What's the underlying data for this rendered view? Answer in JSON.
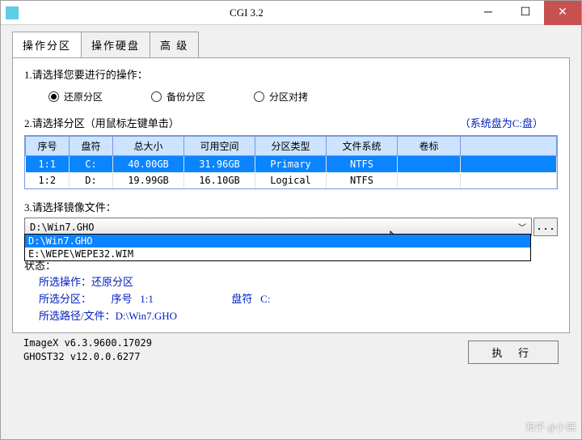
{
  "titlebar": {
    "title": "CGI 3.2"
  },
  "tabs": {
    "t1": "操作分区",
    "t2": "操作硬盘",
    "t3": "高 级"
  },
  "section1": {
    "label": "1.请选择您要进行的操作：",
    "opt_restore": "还原分区",
    "opt_backup": "备份分区",
    "opt_copy": "分区对拷"
  },
  "section2": {
    "label": "2.请选择分区（用鼠标左键单击）",
    "hint": "（系统盘为C:盘）",
    "headers": {
      "seq": "序号",
      "drive": "盘符",
      "total": "总大小",
      "free": "可用空间",
      "ptype": "分区类型",
      "fs": "文件系统",
      "label": "卷标",
      "blank": ""
    },
    "rows": [
      {
        "seq": "1:1",
        "drive": "C:",
        "total": "40.00GB",
        "free": "31.96GB",
        "ptype": "Primary",
        "fs": "NTFS",
        "label": "",
        "selected": true
      },
      {
        "seq": "1:2",
        "drive": "D:",
        "total": "19.99GB",
        "free": "16.10GB",
        "ptype": "Logical",
        "fs": "NTFS",
        "label": "",
        "selected": false
      }
    ]
  },
  "section3": {
    "label": "3.请选择镜像文件：",
    "combo_value": "D:\\Win7.GHO",
    "browse": "...",
    "options": [
      {
        "text": "D:\\Win7.GHO",
        "hl": true
      },
      {
        "text": "E:\\WEPE\\WEPE32.WIM",
        "hl": false
      }
    ]
  },
  "status": {
    "heading": "状态：",
    "op_label": "所选操作：",
    "op_value": "还原分区",
    "part_label": "所选分区：",
    "part_seq_label": "序号",
    "part_seq": "1:1",
    "part_drv_label": "盘符",
    "part_drv": "C:",
    "path_label": "所选路径/文件：",
    "path_value": "D:\\Win7.GHO"
  },
  "bottom": {
    "imagex": "ImageX v6.3.9600.17029",
    "ghost": "GHOST32 v12.0.0.6277",
    "execute": "执 行"
  },
  "watermark": "知乎 @小锦"
}
